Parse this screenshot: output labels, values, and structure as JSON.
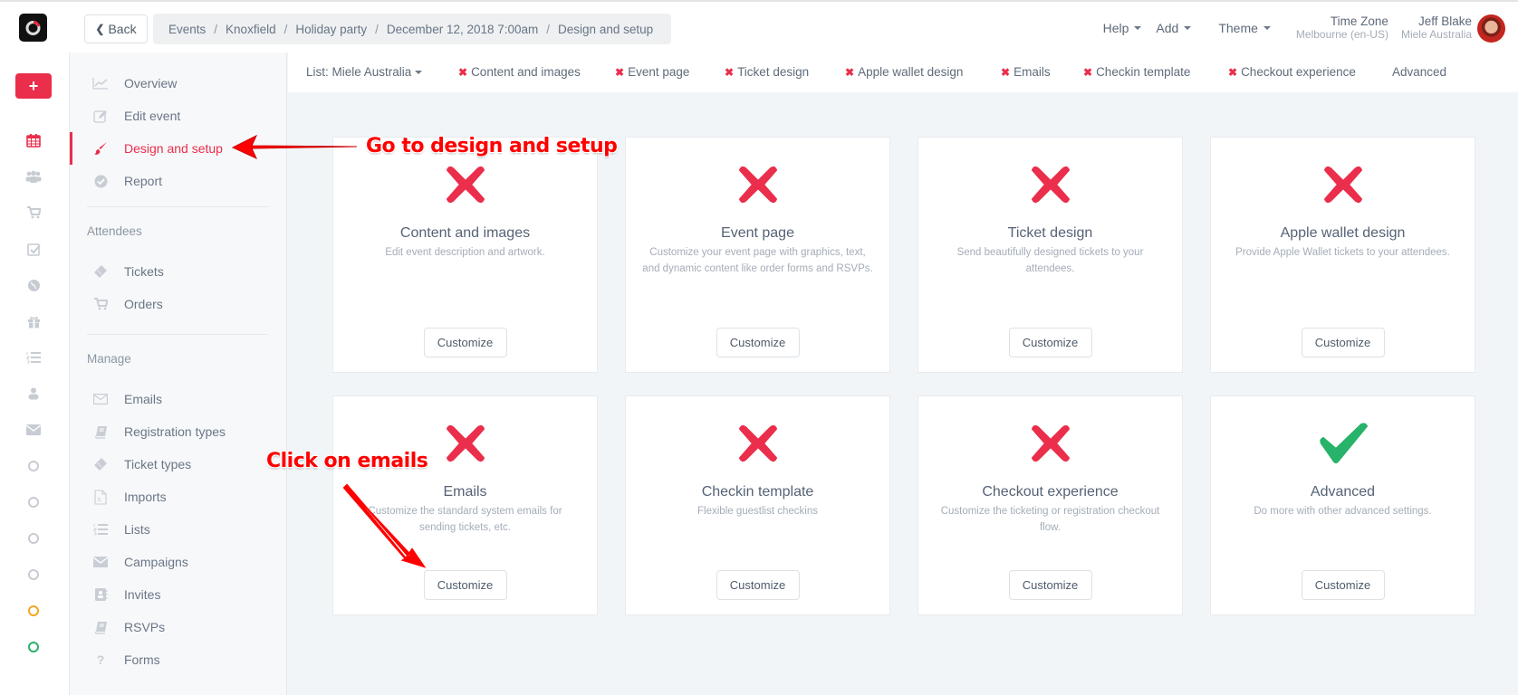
{
  "header": {
    "back_label": "Back",
    "breadcrumb": [
      "Events",
      "Knoxfield",
      "Holiday party",
      "December 12, 2018 7:00am",
      "Design and setup"
    ],
    "menus": [
      {
        "label": "Help",
        "icon": "caret-down-icon"
      },
      {
        "label": "Add",
        "icon": "caret-down-icon"
      },
      {
        "label": "Theme",
        "icon": "caret-down-icon"
      }
    ],
    "timezone": {
      "label": "Time Zone",
      "value": "Melbourne (en-US)"
    },
    "user": {
      "name": "Jeff Blake",
      "org": "Miele Australia"
    }
  },
  "rail": {
    "add_label": "+",
    "icons": [
      "calendar-icon",
      "users-icon",
      "cart-icon",
      "checkbox-icon",
      "globe-icon",
      "gift-icon",
      "list-icon",
      "person-icon",
      "envelope-icon",
      "ring-icon",
      "ring-icon",
      "ring-icon",
      "ring-icon",
      "ring-orange-icon",
      "ring-green-icon"
    ]
  },
  "sidebar": {
    "event_items": [
      {
        "label": "Overview",
        "icon": "chart-line-icon"
      },
      {
        "label": "Edit event",
        "icon": "edit-icon"
      },
      {
        "label": "Design and setup",
        "icon": "paintbrush-icon",
        "active": true
      },
      {
        "label": "Report",
        "icon": "check-circle-icon"
      }
    ],
    "attendees_heading": "Attendees",
    "attendees_items": [
      {
        "label": "Tickets",
        "icon": "ticket-icon"
      },
      {
        "label": "Orders",
        "icon": "cart-icon"
      }
    ],
    "manage_heading": "Manage",
    "manage_items": [
      {
        "label": "Emails",
        "icon": "envelope-outline-icon"
      },
      {
        "label": "Registration types",
        "icon": "book-icon"
      },
      {
        "label": "Ticket types",
        "icon": "ticket-icon"
      },
      {
        "label": "Imports",
        "icon": "excel-file-icon"
      },
      {
        "label": "Lists",
        "icon": "ordered-list-icon"
      },
      {
        "label": "Campaigns",
        "icon": "envelope-icon"
      },
      {
        "label": "Invites",
        "icon": "address-book-icon"
      },
      {
        "label": "RSVPs",
        "icon": "book-icon"
      },
      {
        "label": "Forms",
        "icon": "question-icon"
      }
    ]
  },
  "tabs": {
    "list_selector": "List: Miele Australia",
    "items": [
      {
        "label": "Content and images",
        "status": "incomplete"
      },
      {
        "label": "Event page",
        "status": "incomplete"
      },
      {
        "label": "Ticket design",
        "status": "incomplete"
      },
      {
        "label": "Apple wallet design",
        "status": "incomplete"
      },
      {
        "label": "Emails",
        "status": "incomplete"
      },
      {
        "label": "Checkin template",
        "status": "incomplete"
      },
      {
        "label": "Checkout experience",
        "status": "incomplete"
      },
      {
        "label": "Advanced",
        "status": "none"
      }
    ]
  },
  "cards": [
    {
      "title": "Content and images",
      "description": "Edit event description and artwork.",
      "status": "incomplete",
      "button": "Customize"
    },
    {
      "title": "Event page",
      "description": "Customize your event page with graphics, text, and dynamic content like order forms and RSVPs.",
      "status": "incomplete",
      "button": "Customize"
    },
    {
      "title": "Ticket design",
      "description": "Send beautifully designed tickets to your attendees.",
      "status": "incomplete",
      "button": "Customize"
    },
    {
      "title": "Apple wallet design",
      "description": "Provide Apple Wallet tickets to your attendees.",
      "status": "incomplete",
      "button": "Customize"
    },
    {
      "title": "Emails",
      "description": "Customize the standard system emails for sending tickets, etc.",
      "status": "incomplete",
      "button": "Customize"
    },
    {
      "title": "Checkin template",
      "description": "Flexible guestlist checkins",
      "status": "incomplete",
      "button": "Customize"
    },
    {
      "title": "Checkout experience",
      "description": "Customize the ticketing or registration checkout flow.",
      "status": "incomplete",
      "button": "Customize"
    },
    {
      "title": "Advanced",
      "description": "Do more with other advanced settings.",
      "status": "complete",
      "button": "Customize"
    }
  ],
  "annotations": {
    "go_to_design": "Go to design and setup",
    "click_emails": "Click on emails"
  },
  "colors": {
    "accent": "#ea2e4b",
    "success": "#27b36a",
    "annotation": "#ff0000",
    "ring_orange": "#f5a623",
    "ring_green": "#27b36a"
  }
}
